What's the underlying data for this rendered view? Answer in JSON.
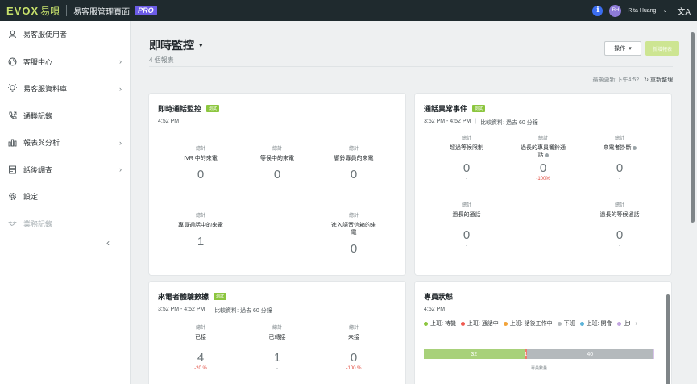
{
  "topbar": {
    "logo_text": "EVOX",
    "logo_zh": "易唄",
    "product": "易客服管理頁面",
    "pro_badge": "PRO",
    "info_glyph": "i",
    "user_initials": "RH",
    "user_name": "Rita Huang",
    "caret": "⌄",
    "lang_glyph": "文A",
    "icons": [
      "info-icon",
      "avatar",
      "translate-icon"
    ]
  },
  "sidebar": {
    "items": [
      {
        "label": "易客服使用者",
        "icon": "user-icon",
        "chevron": false
      },
      {
        "label": "客服中心",
        "icon": "globe-icon",
        "chevron": true
      },
      {
        "label": "易客服資料庫",
        "icon": "bulb-icon",
        "chevron": true
      },
      {
        "label": "通聯記錄",
        "icon": "phone-icon",
        "chevron": false
      },
      {
        "label": "報表與分析",
        "icon": "chart-icon",
        "chevron": true
      },
      {
        "label": "話後調查",
        "icon": "survey-icon",
        "chevron": true
      },
      {
        "label": "設定",
        "icon": "gear-icon",
        "chevron": false
      },
      {
        "label": "業務記錄",
        "icon": "handshake-icon",
        "chevron": false,
        "disabled": true
      }
    ],
    "collapse_glyph": "‹"
  },
  "header": {
    "title": "即時監控",
    "title_caret": "▾",
    "subtitle": "4 個報表",
    "ops_button": "操作",
    "ops_caret": "▾",
    "new_button": "新增報表",
    "last_updated": "最後更新:下午4:52",
    "refresh_glyph": "↻",
    "refresh_label": "重新整理"
  },
  "cards": {
    "live_calls": {
      "title": "即時通話監控",
      "badge": "測試",
      "time": "4:52 PM",
      "metrics": [
        {
          "top": "總計",
          "label": "IVR 中的來電",
          "value": "0"
        },
        {
          "top": "總計",
          "label": "等候中的來電",
          "value": "0"
        },
        {
          "top": "總計",
          "label": "響鈴專員的來電",
          "value": "0"
        },
        {
          "top": "總計",
          "label": "專員通話中的來電",
          "value": "1"
        },
        {
          "top": "總計",
          "label": "進入語音信箱的來電",
          "value": "0"
        }
      ]
    },
    "call_anomalies": {
      "title": "通話異常事件",
      "badge": "測試",
      "time": "3:52 PM - 4:52 PM",
      "compare": "比較資料: 過去 60 分鐘",
      "metrics": [
        {
          "top": "總計",
          "label": "超過等候限制",
          "value": "0",
          "delta": "-"
        },
        {
          "top": "總計",
          "label": "過長的專員響鈴通話",
          "value": "0",
          "delta": "-100%",
          "red": true
        },
        {
          "top": "總計",
          "label": "來電者掛斷",
          "value": "0",
          "delta": "-"
        },
        {
          "top": "總計",
          "label": "過長的通話",
          "value": "0",
          "delta": "-"
        },
        {
          "top": "總計",
          "label": "過長的等候通話",
          "value": "0",
          "delta": "-"
        }
      ]
    },
    "caller_experience": {
      "title": "來電者體驗數據",
      "badge": "測試",
      "time": "3:52 PM - 4:52 PM",
      "compare": "比較資料: 過去 60 分鐘",
      "metrics": [
        {
          "top": "總計",
          "label": "已接",
          "value": "4",
          "delta": "-20 %",
          "red": true
        },
        {
          "top": "總計",
          "label": "已轉接",
          "value": "1",
          "delta": "-"
        },
        {
          "top": "總計",
          "label": "未接",
          "value": "0",
          "delta": "-100 %",
          "red": true
        }
      ]
    },
    "agent_status": {
      "title": "專員狀態",
      "time": "4:52 PM",
      "legend": [
        {
          "label": "上班: 待機",
          "color": "#8cc63f"
        },
        {
          "label": "上班: 通話中",
          "color": "#ef5a50"
        },
        {
          "label": "上班: 話後工作中",
          "color": "#f2a33a"
        },
        {
          "label": "下班",
          "color": "#b4b9bc"
        },
        {
          "label": "上班: 開會",
          "color": "#5db4d9"
        },
        {
          "label": "上I",
          "color": "#c3a6e0"
        }
      ],
      "legend_next": "›",
      "bar": [
        {
          "label": "32",
          "value": 32,
          "color": "#a8d17a"
        },
        {
          "label": "1",
          "value": 1,
          "color": "#ef7b6e"
        },
        {
          "label": "40",
          "value": 40,
          "color": "#b4b9bc"
        },
        {
          "label": "",
          "value": 0.5,
          "color": "#d7c3ea"
        }
      ],
      "axis_label": "專員數量"
    }
  }
}
